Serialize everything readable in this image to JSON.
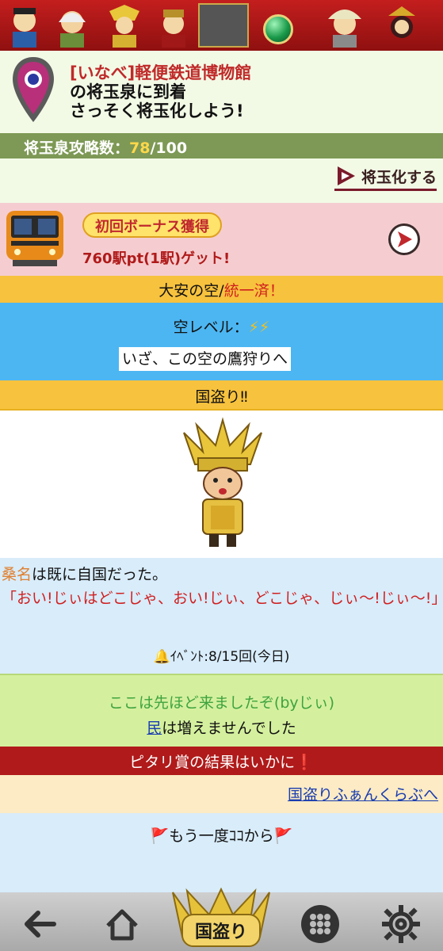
{
  "arrival": {
    "station": "[いなべ]軽便鉄道博物館",
    "line2": "の将玉泉に到着",
    "line3": "さっそく将玉化しよう!"
  },
  "capture": {
    "label": "将玉泉攻略数：",
    "count": "78",
    "total": "/100"
  },
  "convert": {
    "label": "将玉化する"
  },
  "bonus": {
    "badge": "初回ボーナス獲得",
    "points": "760駅pt(1駅)ゲット!"
  },
  "sky": {
    "name": "大安の空/",
    "status": "統一済！",
    "level_label": "空レベル：",
    "level_bolts": "⚡⚡",
    "hunt": "いざ、この空の鷹狩りへ"
  },
  "kunidori": {
    "title": "国盗り‼",
    "place": "桑名",
    "place_suffix": "は既に自国だった。",
    "quote": "「おい!じぃはどこじゃ、おい!じぃ、どこじゃ、じぃ～!じぃ～!」",
    "event_label": "ｲﾍﾞﾝﾄ",
    "event_value": ":8/15回(今日)"
  },
  "visited": {
    "line1": "ここは先ほど来ましたぞ(byじぃ)",
    "people_link": "民",
    "line2_suffix": "は増えませんでした"
  },
  "pitari": {
    "text": "ピタリ賞の結果はいかに",
    "mark": "❗"
  },
  "club": {
    "link": "国盗りふぁんくらぶへ"
  },
  "again": {
    "text": "もう一度ｺｺから"
  },
  "nav": {
    "center_label": "国盗り"
  },
  "colors": {
    "header_red": "#c41e1e",
    "capture_bar": "#7d9955",
    "sky_blue": "#4cb6f2",
    "orange_band": "#f7c23d",
    "pitari_red": "#b01a1a"
  }
}
